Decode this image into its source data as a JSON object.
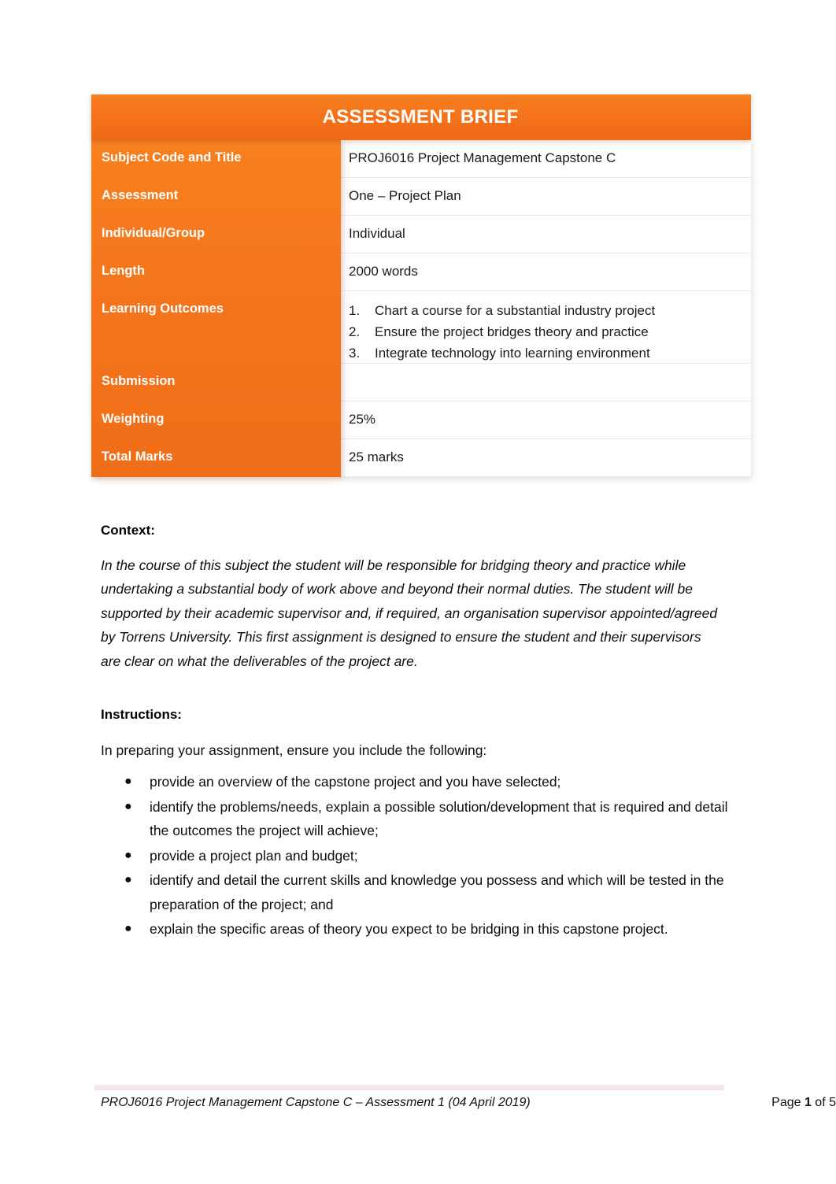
{
  "document": {
    "header_title": "ASSESSMENT BRIEF"
  },
  "brief_table": {
    "rows": [
      {
        "label": "Subject Code and Title",
        "value": "PROJ6016 Project Management Capstone C"
      },
      {
        "label": "Assessment",
        "value": "One – Project Plan"
      },
      {
        "label": "Individual/Group",
        "value": "Individual"
      },
      {
        "label": "Length",
        "value": "2000 words"
      },
      {
        "label": "Learning Outcomes",
        "value": ""
      },
      {
        "label": "Submission",
        "value": ""
      },
      {
        "label": "Weighting",
        "value": "25%"
      },
      {
        "label": "Total Marks",
        "value": "25 marks"
      }
    ],
    "learning_outcomes": [
      {
        "num": "1.",
        "text": "Chart a course for a substantial industry project"
      },
      {
        "num": "2.",
        "text": "Ensure the project bridges theory and practice"
      },
      {
        "num": "3.",
        "text": "Integrate technology into learning environment"
      }
    ]
  },
  "context": {
    "heading": "Context:",
    "paragraph": "In the course of this subject the student will be responsible for bridging theory and practice while undertaking a substantial body of work above and beyond their normal duties.  The student will be supported by their academic supervisor and, if required, an organisation supervisor appointed/agreed by Torrens University.  This first assignment is designed to ensure the student and their supervisors are clear on what the deliverables of the project are."
  },
  "instructions": {
    "heading": "Instructions:",
    "intro": "In preparing your assignment, ensure you include the following:",
    "bullet_glyph": "●",
    "items": [
      "provide an overview of the capstone project and you have selected;",
      "identify the problems/needs, explain a possible solution/development that is required and detail the outcomes the project will achieve;",
      "provide a project plan and budget;",
      "identify and detail the current skills and knowledge you possess and which will be tested in the preparation of the project; and",
      "explain the specific areas of theory you expect to be bridging in this capstone project."
    ]
  },
  "footer": {
    "left": "PROJ6016 Project Management Capstone C – Assessment 1 (04 April 2019)",
    "page_prefix": "Page ",
    "page_number": "1",
    "page_suffix": " of 5"
  },
  "colors": {
    "brand_orange": "#F4741B",
    "header_orange": "#F7801F",
    "footer_rule": "#F2E2E2"
  }
}
